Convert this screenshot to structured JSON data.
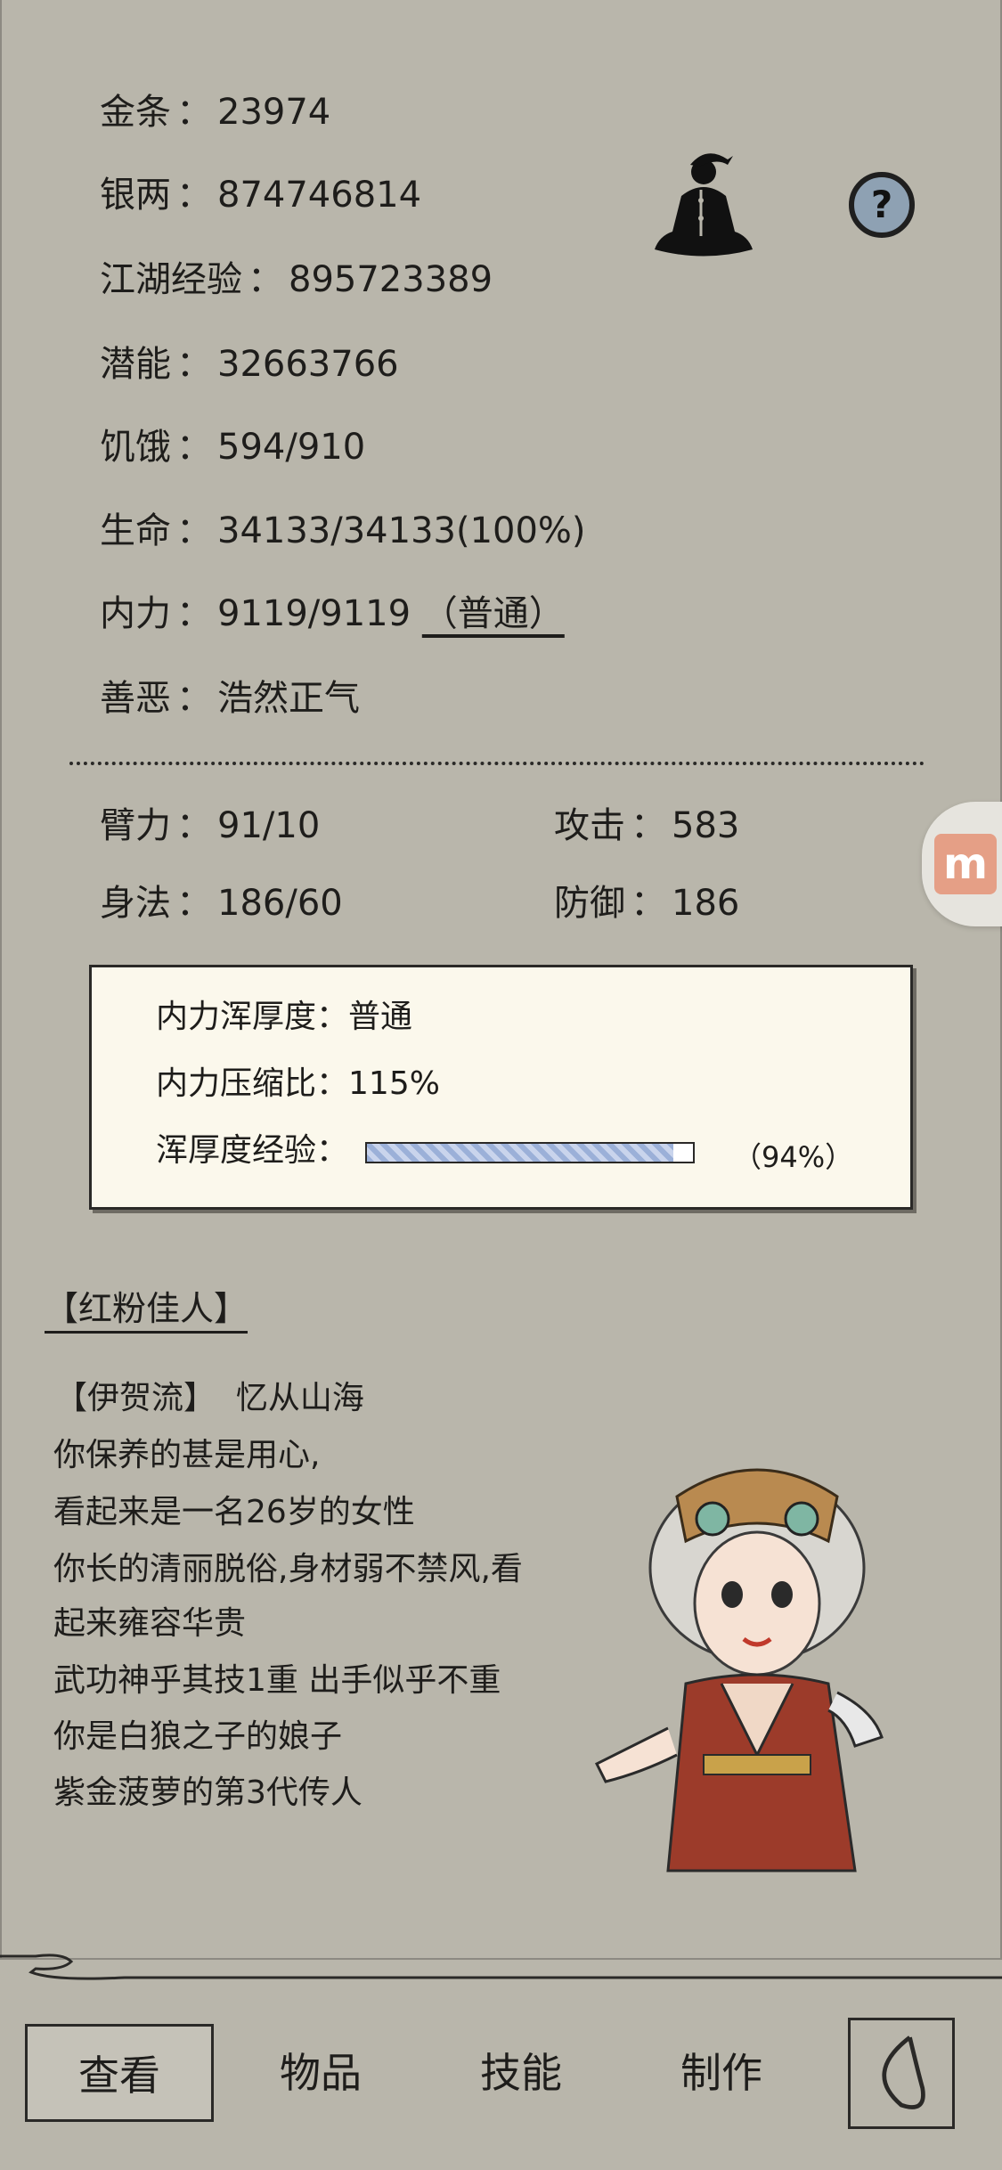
{
  "stats": {
    "gold": {
      "label": "金条",
      "sep": "：",
      "value": "23974"
    },
    "silver": {
      "label": "银两",
      "sep": "：",
      "value": "874746814"
    },
    "exp": {
      "label": "江湖经验",
      "sep": "：",
      "value": "895723389"
    },
    "potential": {
      "label": "潜能",
      "sep": "：",
      "value": "32663766"
    },
    "hunger": {
      "label": "饥饿",
      "sep": "：",
      "value": "594/910"
    },
    "life": {
      "label": "生命",
      "sep": "：",
      "value": "34133/34133(100%)"
    },
    "inner": {
      "label": "内力",
      "sep": "：",
      "value": "9119/9119",
      "link": "（普通）"
    },
    "morality": {
      "label": "善恶",
      "sep": "：",
      "value": "浩然正气"
    }
  },
  "attributes": {
    "arm": {
      "label": "臂力",
      "sep": "：",
      "value": "91/10"
    },
    "attack": {
      "label": "攻击",
      "sep": "：",
      "value": "583"
    },
    "agility": {
      "label": "身法",
      "sep": "：",
      "value": "186/60"
    },
    "defense": {
      "label": "防御",
      "sep": "：",
      "value": "186"
    }
  },
  "popup": {
    "thickness_label": "内力浑厚度：",
    "thickness_value": "普通",
    "ratio_label": "内力压缩比：",
    "ratio_value": "115%",
    "exp_label": "浑厚度经验：",
    "exp_percent_text": "（94%）",
    "exp_progress": 0.94
  },
  "profile": {
    "title": "【红粉佳人】",
    "school": "【伊贺流】",
    "motto": "忆从山海",
    "lines": [
      "你保养的甚是用心,",
      "看起来是一名26岁的女性",
      "你长的清丽脱俗,身材弱不禁风,看",
      "起来雍容华贵",
      "武功神乎其技1重 出手似乎不重",
      "你是白狼之子的娘子",
      "紫金菠萝的第3代传人"
    ]
  },
  "side_tab": {
    "letter": "m"
  },
  "nav": {
    "tabs": [
      "查看",
      "物品",
      "技能",
      "制作"
    ]
  },
  "icons": {
    "meditate": "meditate-icon",
    "help": "help-icon",
    "back": "back-icon"
  }
}
